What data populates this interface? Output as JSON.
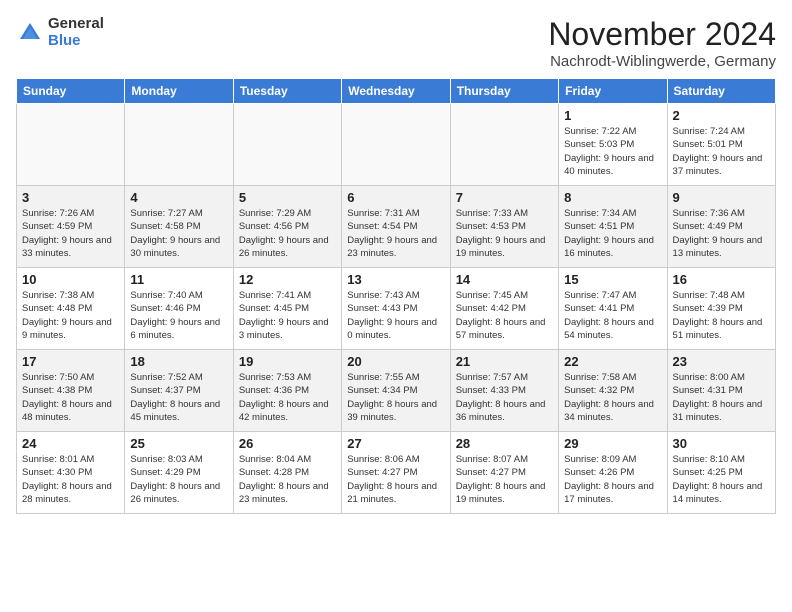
{
  "header": {
    "logo_general": "General",
    "logo_blue": "Blue",
    "month_title": "November 2024",
    "location": "Nachrodt-Wiblingwerde, Germany"
  },
  "weekdays": [
    "Sunday",
    "Monday",
    "Tuesday",
    "Wednesday",
    "Thursday",
    "Friday",
    "Saturday"
  ],
  "weeks": [
    [
      {
        "day": "",
        "info": ""
      },
      {
        "day": "",
        "info": ""
      },
      {
        "day": "",
        "info": ""
      },
      {
        "day": "",
        "info": ""
      },
      {
        "day": "",
        "info": ""
      },
      {
        "day": "1",
        "info": "Sunrise: 7:22 AM\nSunset: 5:03 PM\nDaylight: 9 hours\nand 40 minutes."
      },
      {
        "day": "2",
        "info": "Sunrise: 7:24 AM\nSunset: 5:01 PM\nDaylight: 9 hours\nand 37 minutes."
      }
    ],
    [
      {
        "day": "3",
        "info": "Sunrise: 7:26 AM\nSunset: 4:59 PM\nDaylight: 9 hours\nand 33 minutes."
      },
      {
        "day": "4",
        "info": "Sunrise: 7:27 AM\nSunset: 4:58 PM\nDaylight: 9 hours\nand 30 minutes."
      },
      {
        "day": "5",
        "info": "Sunrise: 7:29 AM\nSunset: 4:56 PM\nDaylight: 9 hours\nand 26 minutes."
      },
      {
        "day": "6",
        "info": "Sunrise: 7:31 AM\nSunset: 4:54 PM\nDaylight: 9 hours\nand 23 minutes."
      },
      {
        "day": "7",
        "info": "Sunrise: 7:33 AM\nSunset: 4:53 PM\nDaylight: 9 hours\nand 19 minutes."
      },
      {
        "day": "8",
        "info": "Sunrise: 7:34 AM\nSunset: 4:51 PM\nDaylight: 9 hours\nand 16 minutes."
      },
      {
        "day": "9",
        "info": "Sunrise: 7:36 AM\nSunset: 4:49 PM\nDaylight: 9 hours\nand 13 minutes."
      }
    ],
    [
      {
        "day": "10",
        "info": "Sunrise: 7:38 AM\nSunset: 4:48 PM\nDaylight: 9 hours\nand 9 minutes."
      },
      {
        "day": "11",
        "info": "Sunrise: 7:40 AM\nSunset: 4:46 PM\nDaylight: 9 hours\nand 6 minutes."
      },
      {
        "day": "12",
        "info": "Sunrise: 7:41 AM\nSunset: 4:45 PM\nDaylight: 9 hours\nand 3 minutes."
      },
      {
        "day": "13",
        "info": "Sunrise: 7:43 AM\nSunset: 4:43 PM\nDaylight: 9 hours\nand 0 minutes."
      },
      {
        "day": "14",
        "info": "Sunrise: 7:45 AM\nSunset: 4:42 PM\nDaylight: 8 hours\nand 57 minutes."
      },
      {
        "day": "15",
        "info": "Sunrise: 7:47 AM\nSunset: 4:41 PM\nDaylight: 8 hours\nand 54 minutes."
      },
      {
        "day": "16",
        "info": "Sunrise: 7:48 AM\nSunset: 4:39 PM\nDaylight: 8 hours\nand 51 minutes."
      }
    ],
    [
      {
        "day": "17",
        "info": "Sunrise: 7:50 AM\nSunset: 4:38 PM\nDaylight: 8 hours\nand 48 minutes."
      },
      {
        "day": "18",
        "info": "Sunrise: 7:52 AM\nSunset: 4:37 PM\nDaylight: 8 hours\nand 45 minutes."
      },
      {
        "day": "19",
        "info": "Sunrise: 7:53 AM\nSunset: 4:36 PM\nDaylight: 8 hours\nand 42 minutes."
      },
      {
        "day": "20",
        "info": "Sunrise: 7:55 AM\nSunset: 4:34 PM\nDaylight: 8 hours\nand 39 minutes."
      },
      {
        "day": "21",
        "info": "Sunrise: 7:57 AM\nSunset: 4:33 PM\nDaylight: 8 hours\nand 36 minutes."
      },
      {
        "day": "22",
        "info": "Sunrise: 7:58 AM\nSunset: 4:32 PM\nDaylight: 8 hours\nand 34 minutes."
      },
      {
        "day": "23",
        "info": "Sunrise: 8:00 AM\nSunset: 4:31 PM\nDaylight: 8 hours\nand 31 minutes."
      }
    ],
    [
      {
        "day": "24",
        "info": "Sunrise: 8:01 AM\nSunset: 4:30 PM\nDaylight: 8 hours\nand 28 minutes."
      },
      {
        "day": "25",
        "info": "Sunrise: 8:03 AM\nSunset: 4:29 PM\nDaylight: 8 hours\nand 26 minutes."
      },
      {
        "day": "26",
        "info": "Sunrise: 8:04 AM\nSunset: 4:28 PM\nDaylight: 8 hours\nand 23 minutes."
      },
      {
        "day": "27",
        "info": "Sunrise: 8:06 AM\nSunset: 4:27 PM\nDaylight: 8 hours\nand 21 minutes."
      },
      {
        "day": "28",
        "info": "Sunrise: 8:07 AM\nSunset: 4:27 PM\nDaylight: 8 hours\nand 19 minutes."
      },
      {
        "day": "29",
        "info": "Sunrise: 8:09 AM\nSunset: 4:26 PM\nDaylight: 8 hours\nand 17 minutes."
      },
      {
        "day": "30",
        "info": "Sunrise: 8:10 AM\nSunset: 4:25 PM\nDaylight: 8 hours\nand 14 minutes."
      }
    ]
  ]
}
